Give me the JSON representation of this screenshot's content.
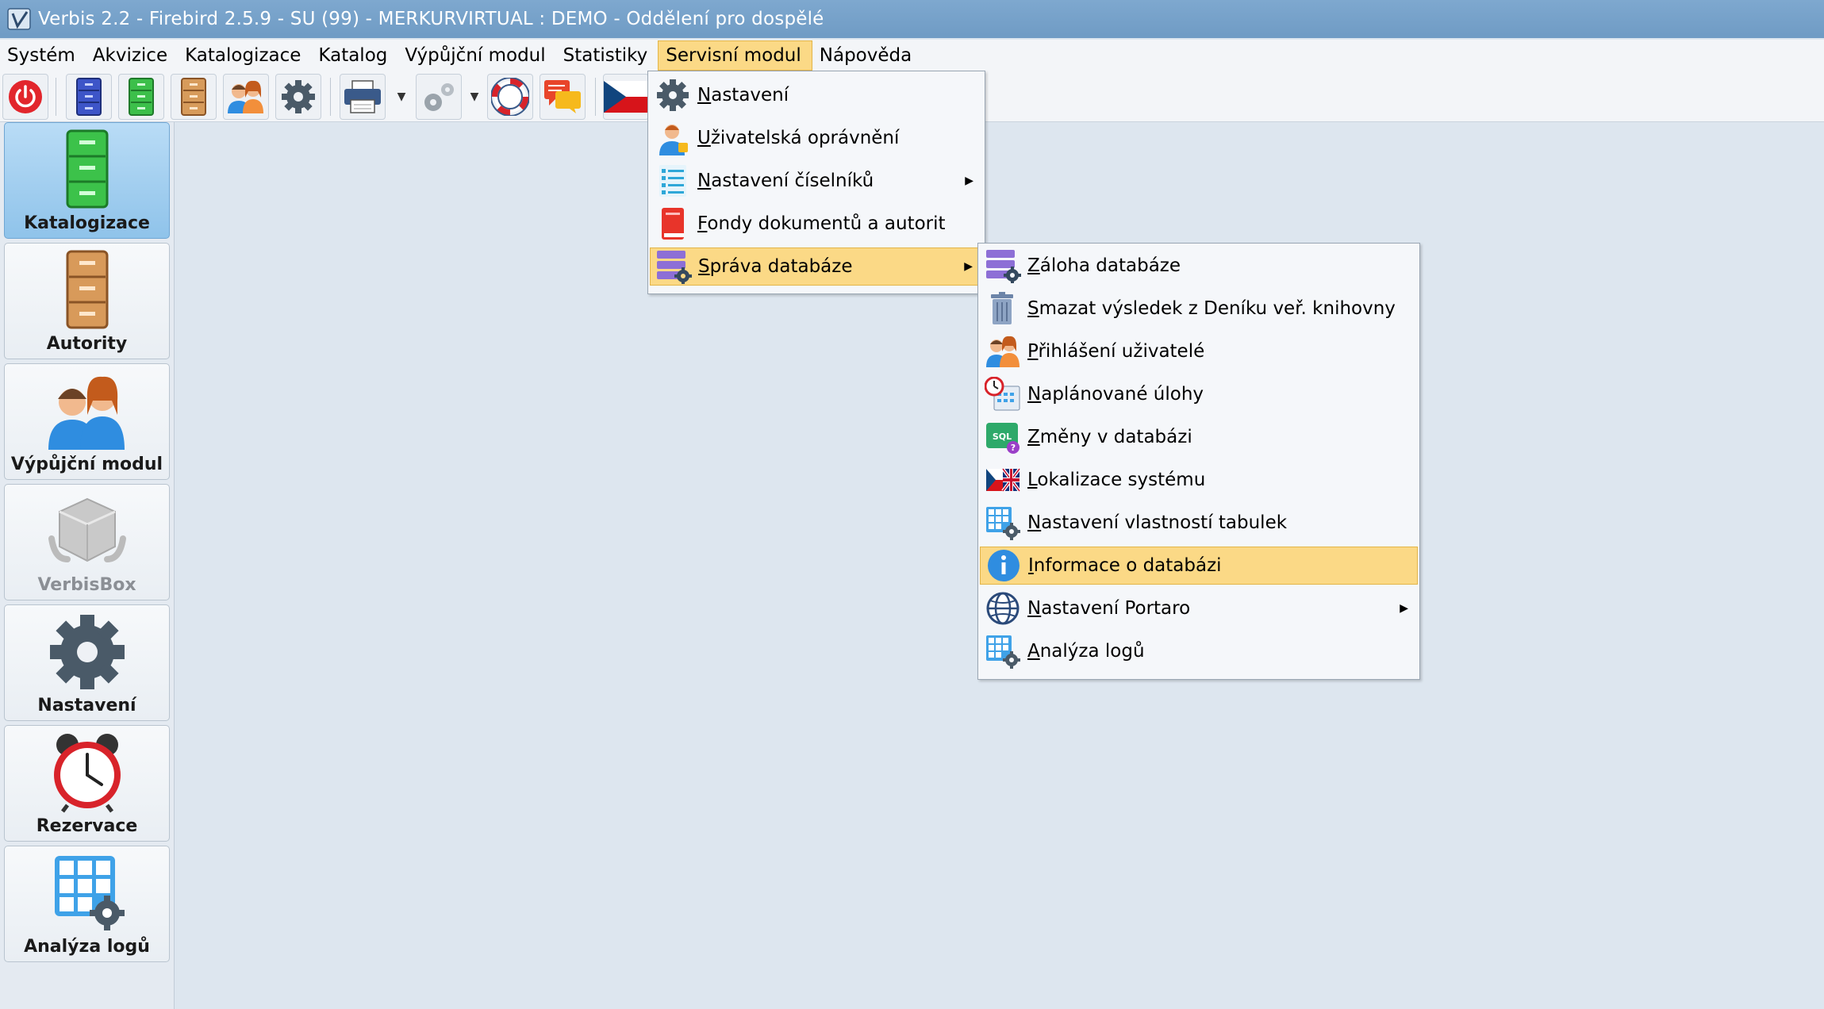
{
  "window": {
    "title": "Verbis 2.2 - Firebird 2.5.9 - SU (99) - MERKURVIRTUAL : DEMO - Oddělení pro dospělé"
  },
  "menubar": {
    "items": [
      {
        "label": "Systém"
      },
      {
        "label": "Akvizice"
      },
      {
        "label": "Katalogizace"
      },
      {
        "label": "Katalog"
      },
      {
        "label": "Výpůjční modul"
      },
      {
        "label": "Statistiky"
      },
      {
        "label": "Servisní modul",
        "active": true
      },
      {
        "label": "Nápověda"
      }
    ]
  },
  "toolbar": {
    "buttons": [
      "power-icon",
      "blue-cabinet-icon",
      "green-cabinet-icon",
      "brown-cabinet-icon",
      "users-icon",
      "gear-icon",
      "printer-icon",
      "gears-icon",
      "lifebuoy-icon",
      "chat-icon",
      "czech-flag-icon"
    ]
  },
  "sidebar": {
    "items": [
      {
        "label": "Katalogizace",
        "icon": "green-cabinet-icon",
        "selected": true
      },
      {
        "label": "Autority",
        "icon": "brown-cabinet-icon"
      },
      {
        "label": "Výpůjční modul",
        "icon": "users-icon"
      },
      {
        "label": "VerbisBox",
        "icon": "box-icon",
        "disabled": true
      },
      {
        "label": "Nastavení",
        "icon": "gear-icon"
      },
      {
        "label": "Rezervace",
        "icon": "alarm-clock-icon"
      },
      {
        "label": "Analýza logů",
        "icon": "grid-gear-icon"
      }
    ]
  },
  "service_menu": {
    "items": [
      {
        "label": "Nastavení",
        "icon": "gear-icon"
      },
      {
        "label": "Uživatelská oprávnění",
        "icon": "user-icon"
      },
      {
        "label": "Nastavení číselníků",
        "icon": "list-icon",
        "submenu": true
      },
      {
        "label": "Fondy dokumentů a autorit",
        "icon": "book-icon"
      },
      {
        "label": "Správa databáze",
        "icon": "database-gear-icon",
        "submenu": true,
        "highlighted": true
      }
    ]
  },
  "db_submenu": {
    "items": [
      {
        "label": "Záloha databáze",
        "icon": "database-gear-icon"
      },
      {
        "label": "Smazat výsledek z Deníku veř. knihovny",
        "icon": "trash-icon"
      },
      {
        "label": "Přihlášení uživatelé",
        "icon": "users-icon"
      },
      {
        "label": "Naplánované úlohy",
        "icon": "calendar-clock-icon"
      },
      {
        "label": "Změny v databázi",
        "icon": "sql-icon"
      },
      {
        "label": "Lokalizace systému",
        "icon": "flags-icon"
      },
      {
        "label": "Nastavení vlastností tabulek",
        "icon": "grid-gear-icon"
      },
      {
        "label": "Informace o databázi",
        "icon": "info-icon",
        "highlighted": true
      },
      {
        "label": "Nastavení Portaro",
        "icon": "globe-icon",
        "submenu": true
      },
      {
        "label": "Analýza logů",
        "icon": "grid-gear-icon"
      }
    ]
  },
  "colors": {
    "highlight": "#fbd986",
    "titlebar": "#7ea8cf",
    "sidebar_selected": "#9fcdf0",
    "background": "#dde6ef"
  }
}
